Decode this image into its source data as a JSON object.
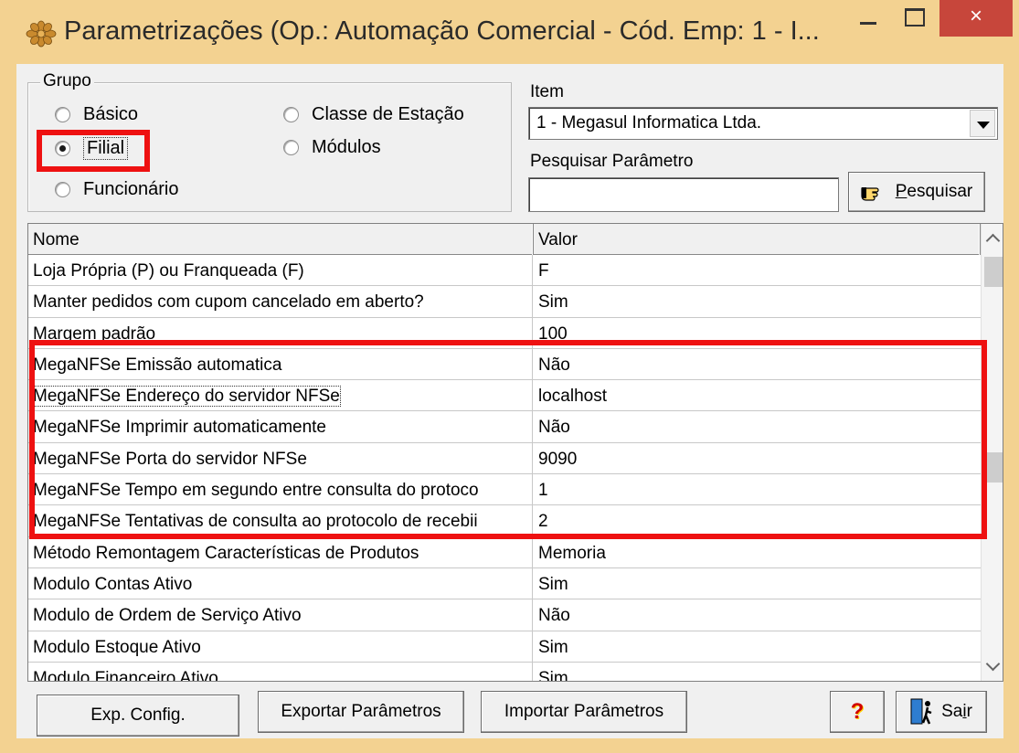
{
  "window": {
    "title": "Parametrizações (Op.: Automação Comercial - Cód. Emp: 1 - I...",
    "close_glyph": "×"
  },
  "group": {
    "legend": "Grupo",
    "options": {
      "basico": "Básico",
      "filial": "Filial",
      "funcionario": "Funcionário",
      "classe": "Classe de Estação",
      "modulos": "Módulos"
    },
    "selected": "Filial"
  },
  "item": {
    "label": "Item",
    "value": "1 - Megasul Informatica Ltda."
  },
  "search": {
    "label": "Pesquisar Parâmetro",
    "value": "",
    "button_prefix": "",
    "button_underlined": "P",
    "button_rest": "esquisar"
  },
  "grid": {
    "columns": [
      "Nome",
      "Valor"
    ],
    "rows": [
      {
        "name": "Loja Própria (P) ou Franqueada (F)",
        "value": "F"
      },
      {
        "name": "Manter pedidos com cupom cancelado em aberto?",
        "value": "Sim"
      },
      {
        "name": "Margem padrão",
        "value": "100"
      },
      {
        "name": "MegaNFSe Emissão automatica",
        "value": "Não"
      },
      {
        "name": "MegaNFSe Endereço do servidor NFSe",
        "value": "localhost"
      },
      {
        "name": "MegaNFSe Imprimir automaticamente",
        "value": "Não"
      },
      {
        "name": "MegaNFSe Porta do servidor NFSe",
        "value": "9090"
      },
      {
        "name": "MegaNFSe Tempo em segundo entre consulta do protoco",
        "value": "1"
      },
      {
        "name": "MegaNFSe Tentativas de consulta ao protocolo de recebii",
        "value": "2"
      },
      {
        "name": "Método Remontagem Características de Produtos",
        "value": "Memoria"
      },
      {
        "name": "Modulo Contas Ativo",
        "value": "Sim"
      },
      {
        "name": "Modulo de Ordem de Serviço Ativo",
        "value": "Não"
      },
      {
        "name": "Modulo Estoque Ativo",
        "value": "Sim"
      },
      {
        "name": "Modulo Financeiro Ativo",
        "value": "Sim"
      }
    ]
  },
  "buttons": {
    "exp_config": "Exp. Config.",
    "exportar": "Exportar Parâmetros",
    "importar": "Importar Parâmetros",
    "help": "?",
    "sair_prefix": "Sa",
    "sair_underlined": "i",
    "sair_rest": "r"
  },
  "colors": {
    "title_bg": "#f3d291",
    "close_bg": "#c7463b",
    "highlight_red": "#ee1111"
  }
}
